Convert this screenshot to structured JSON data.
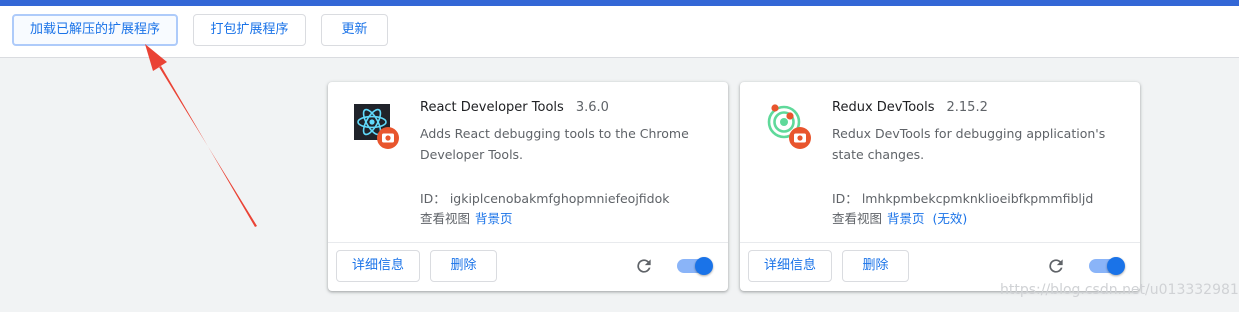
{
  "toolbar": {
    "load_unpacked": "加载已解压的扩展程序",
    "pack_extension": "打包扩展程序",
    "update": "更新"
  },
  "extensions": [
    {
      "name": "React Developer Tools",
      "version": "3.6.0",
      "description": "Adds React debugging tools to the Chrome Developer Tools.",
      "id_label": "ID：",
      "id": "igkiplcenobakmfghopmniefeojfidok",
      "inspect_label": "查看视图",
      "background_link": "背景页",
      "details_button": "详细信息",
      "remove_button": "删除",
      "enabled": true
    },
    {
      "name": "Redux DevTools",
      "version": "2.15.2",
      "description": "Redux DevTools for debugging application's state changes.",
      "id_label": "ID：",
      "id": "lmhkpmbekcpmknklioeibfkpmmfibljd",
      "inspect_label": "查看视图",
      "background_link": "背景页",
      "inactive_label": "(无效)",
      "details_button": "详细信息",
      "remove_button": "删除",
      "enabled": true
    }
  ],
  "watermark": "https://blog.csdn.net/u013332981",
  "colors": {
    "accent": "#1a73e8",
    "top_bar": "#3367d6",
    "annotation_arrow": "#ea4335"
  }
}
